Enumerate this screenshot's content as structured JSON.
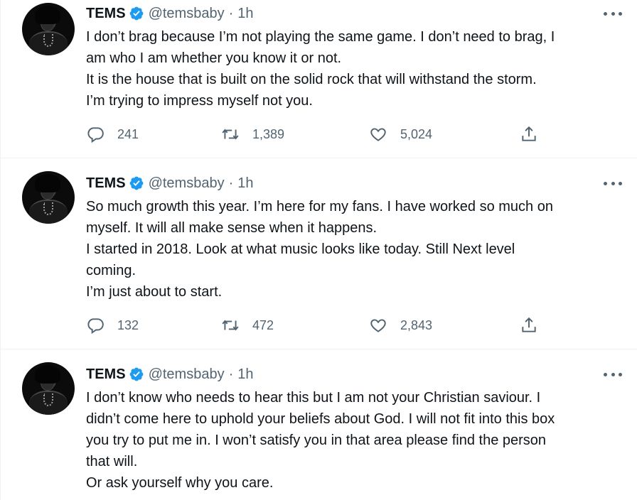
{
  "tweets": [
    {
      "name": "TEMS",
      "handle": "@temsbaby",
      "separator": "·",
      "time": "1h",
      "lines": [
        "I don’t brag because I’m not playing the same game. I don’t need to brag, I",
        "am who I am whether you know it or not.",
        "It is the house that is built on the solid rock that will withstand the storm.",
        "I’m trying to impress myself not you."
      ],
      "replies": "241",
      "retweets": "1,389",
      "likes": "5,024"
    },
    {
      "name": "TEMS",
      "handle": "@temsbaby",
      "separator": "·",
      "time": "1h",
      "lines": [
        "So much growth this year. I’m here for my fans. I have worked so much on",
        "myself. It will all make sense when it happens.",
        "I started in 2018. Look at what music looks like today. Still Next level",
        "coming.",
        "I’m just about to start."
      ],
      "replies": "132",
      "retweets": "472",
      "likes": "2,843"
    },
    {
      "name": "TEMS",
      "handle": "@temsbaby",
      "separator": "·",
      "time": "1h",
      "lines": [
        "I don’t know who needs to hear this but I am not your Christian saviour. I",
        "didn’t come here to uphold your beliefs about God. I will not fit into this box",
        "you try to put me in. I won’t satisfy you in that area please find the person",
        "that will.",
        "Or ask yourself why you care."
      ]
    }
  ],
  "icons": {
    "verified": "verified-badge-icon",
    "more": "more-options-icon",
    "reply": "reply-icon",
    "retweet": "retweet-icon",
    "like": "heart-icon",
    "share": "share-icon"
  },
  "colors": {
    "verified": "#1d9bf0",
    "secondary_text": "#536471",
    "primary_text": "#0f1419",
    "divider": "#eff3f4"
  }
}
